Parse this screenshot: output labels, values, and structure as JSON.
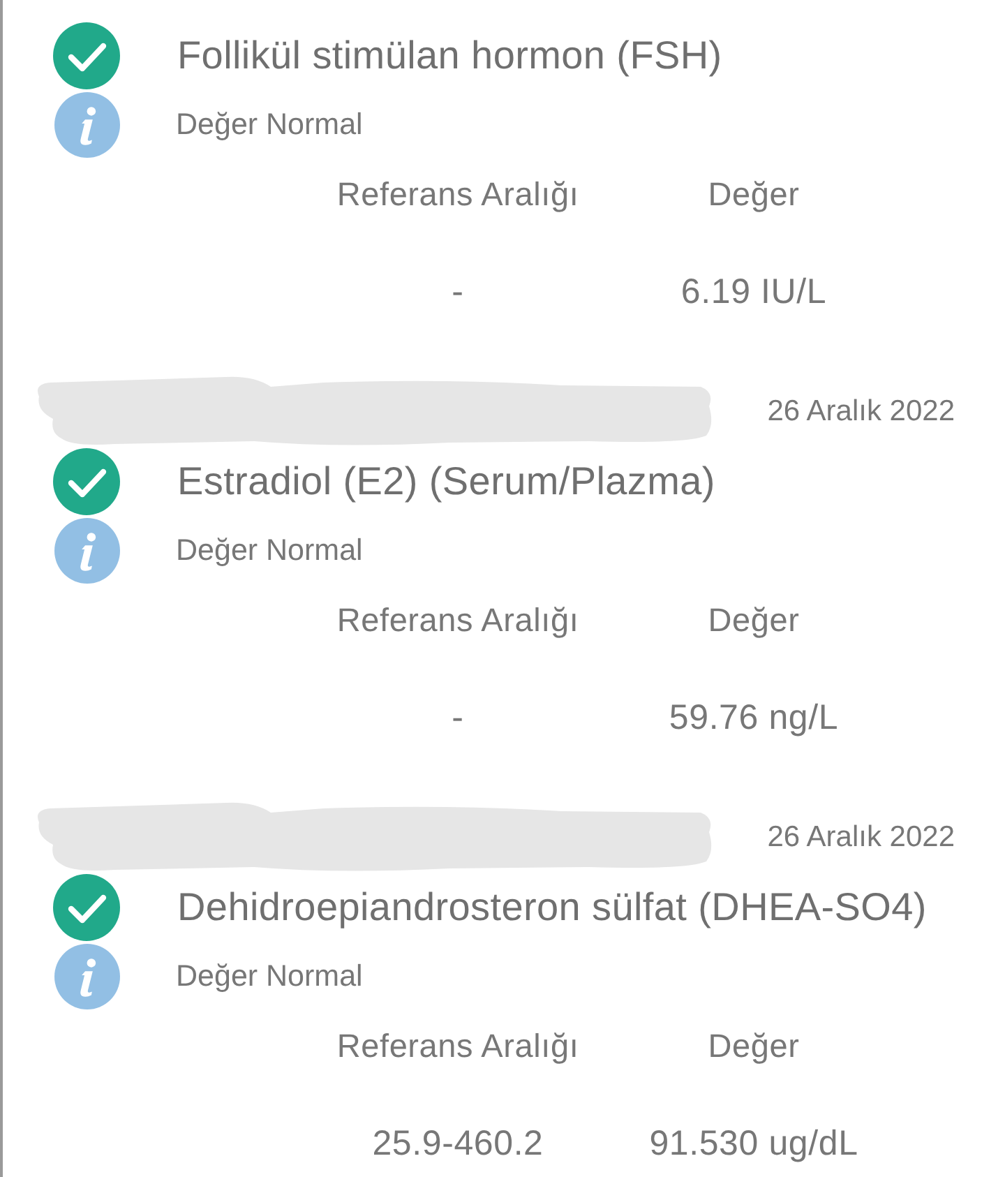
{
  "results": [
    {
      "name": "Follikül stimülan hormon (FSH)",
      "in_range": true,
      "status_text": "Değer Normal",
      "reference_header": "Referans Aralığı",
      "value_header": "Değer",
      "reference_range": "-",
      "value": "6.19 IU/L"
    },
    {
      "source_redacted": true,
      "date": "26 Aralık 2022",
      "name": "Estradiol (E2) (Serum/Plazma)",
      "in_range": true,
      "status_text": "Değer Normal",
      "reference_header": "Referans Aralığı",
      "value_header": "Değer",
      "reference_range": "-",
      "value": "59.76 ng/L"
    },
    {
      "source_redacted": true,
      "date": "26 Aralık 2022",
      "name": "Dehidroepiandrosteron sülfat (DHEA-SO4)",
      "in_range": true,
      "status_text": "Değer Normal",
      "reference_header": "Referans Aralığı",
      "value_header": "Değer",
      "reference_range": "25.9-460.2",
      "value": "91.530 ug/dL"
    }
  ]
}
